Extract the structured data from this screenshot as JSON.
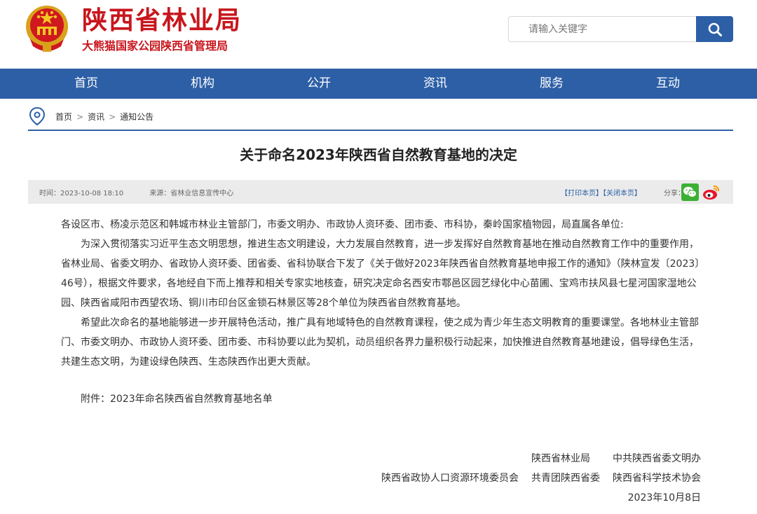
{
  "header": {
    "site_title": "陕西省林业局",
    "site_subtitle": "大熊猫国家公园陕西省管理局",
    "emblem_icon": "national-emblem-icon",
    "search_placeholder": "请输入关键字",
    "accent_red": "#c8161d",
    "accent_blue": "#2d5fa6"
  },
  "nav": {
    "items": [
      "首页",
      "机构",
      "公开",
      "资讯",
      "服务",
      "互动"
    ]
  },
  "breadcrumb": {
    "items": [
      "首页",
      "资讯",
      "通知公告"
    ],
    "separator": ">"
  },
  "article": {
    "title": "关于命名2023年陕西省自然教育基地的决定",
    "time_label": "时间：2023-10-08 18:10",
    "source_label": "来源：省林业信息宣传中心",
    "print_label": "【打印本页】",
    "close_label": "【关闭本页】",
    "share_label": "分享：",
    "paragraphs": [
      "各设区市、杨凌示范区和韩城市林业主管部门，市委文明办、市政协人资环委、团市委、市科协，秦岭国家植物园，局直属各单位:",
      "为深入贯彻落实习近平生态文明思想，推进生态文明建设，大力发展自然教育，进一步发挥好自然教育基地在推动自然教育工作中的重要作用，省林业局、省委文明办、省政协人资环委、团省委、省科协联合下发了《关于做好2023年陕西省自然教育基地申报工作的通知》（陕林宣发〔2023〕46号），根据文件要求，各地经自下而上推荐和相关专家实地核查，研究决定命名西安市鄠邑区园艺绿化中心苗圃、宝鸡市扶风县七星河国家湿地公园、陕西省咸阳市西望农场、铜川市印台区金锁石林景区等28个单位为陕西省自然教育基地。",
      "希望此次命名的基地能够进一步开展特色活动，推广具有地域特色的自然教育课程，使之成为青少年生态文明教育的重要课堂。各地林业主管部门、市委文明办、市政协人资环委、团市委、市科协要以此为契机，动员组织各界力量积极行动起来，加快推进自然教育基地建设，倡导绿色生活，共建生态文明，为建设绿色陕西、生态陕西作出更大贡献。"
    ],
    "attachment": "附件：2023年命名陕西省自然教育基地名单",
    "signatures": {
      "row1": [
        "陕西省林业局",
        "中共陕西省委文明办"
      ],
      "row2": [
        "陕西省政协人口资源环境委员会",
        "共青团陕西省委",
        "陕西省科学技术协会"
      ],
      "date": "2023年10月8日"
    }
  }
}
